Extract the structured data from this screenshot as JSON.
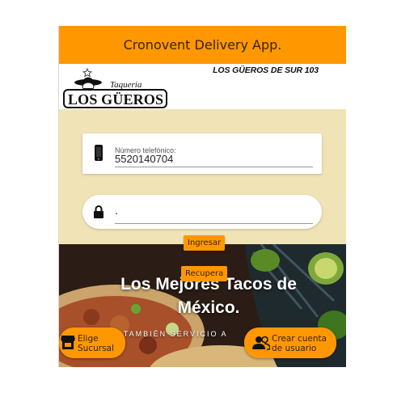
{
  "app": {
    "title": "Cronovent Delivery App."
  },
  "header": {
    "branch": "LOS GÜEROS DE SUR 103",
    "logo": {
      "script": "Taqueria",
      "name": "LOS GÜEROS"
    }
  },
  "login": {
    "phone_label": "Número telefónico:",
    "phone_value": "5520140704",
    "password_value": "."
  },
  "buttons": {
    "ingresar": "Ingresar",
    "recupera": "Recupera"
  },
  "hero": {
    "title_line1": "Los Mejores Tacos de",
    "title_line2": "México.",
    "subtitle": "A TAMBIÉN SERVICIO A"
  },
  "actions": {
    "sucursal_line1": "Elige",
    "sucursal_line2": "Sucursal",
    "crear_line1": "Crear cuenta",
    "crear_line2": "de usuario"
  },
  "colors": {
    "accent": "#ff9800",
    "background": "#f0e4b6"
  }
}
